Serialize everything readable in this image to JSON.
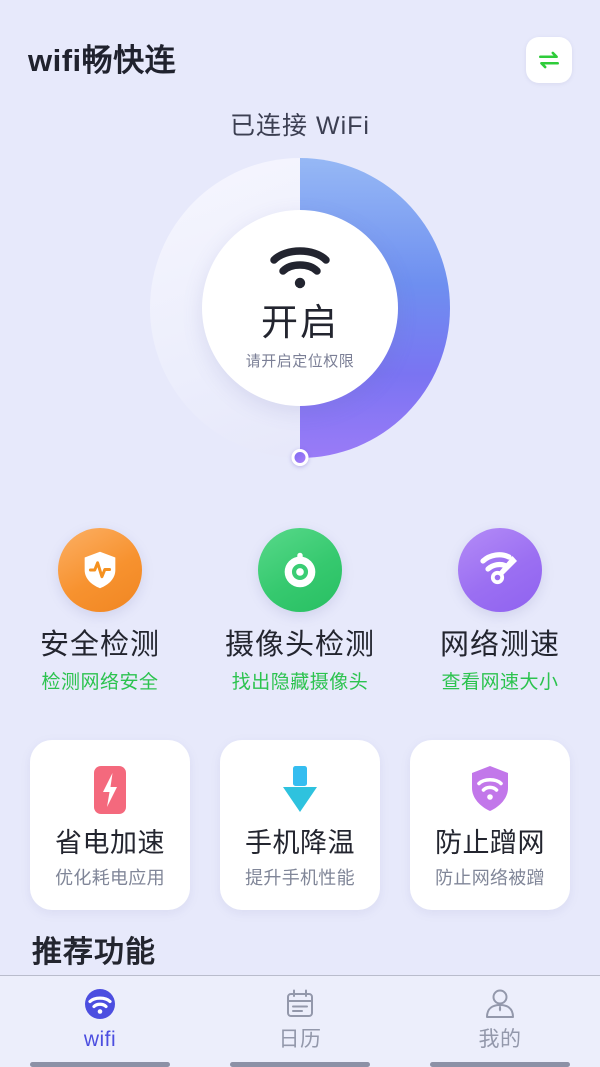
{
  "header": {
    "app_title": "wifi畅快连",
    "swap_button_icon": "swap-arrows-icon",
    "swap_button_color": "#2ecc3a"
  },
  "status": {
    "connected_label": "已连接 WiFi"
  },
  "gauge": {
    "main_text": "开启",
    "sub_text": "请开启定位权限",
    "wifi_icon": "wifi-icon",
    "track_color": "#eceefc",
    "arc_gradient_start": "#96b8f5",
    "arc_gradient_end": "#9a7bf7",
    "knob_color": "#8b72f5",
    "progress_percent": 50
  },
  "round_features": [
    {
      "title": "安全检测",
      "subtitle": "检测网络安全",
      "icon": "shield-pulse-icon",
      "color": "#f7922f"
    },
    {
      "title": "摄像头检测",
      "subtitle": "找出隐藏摄像头",
      "icon": "camera-lens-icon",
      "color": "#36c96f"
    },
    {
      "title": "网络测速",
      "subtitle": "查看网速大小",
      "icon": "wifi-speedometer-icon",
      "color": "#9b6ff2"
    }
  ],
  "card_features": [
    {
      "title": "省电加速",
      "subtitle": "优化耗电应用",
      "icon": "battery-bolt-icon",
      "color": "#f4697d"
    },
    {
      "title": "手机降温",
      "subtitle": "提升手机性能",
      "icon": "arrow-down-icon",
      "color": "#35bdf0"
    },
    {
      "title": "防止蹭网",
      "subtitle": "防止网络被蹭",
      "icon": "shield-wifi-icon",
      "color": "#c277ea"
    }
  ],
  "sections": {
    "recommended_title": "推荐功能"
  },
  "bottom_nav": {
    "active_color": "#4c4ee0",
    "inactive_color": "#9398ab",
    "items": [
      {
        "label": "wifi",
        "icon": "wifi-icon"
      },
      {
        "label": "日历",
        "icon": "calendar-icon"
      },
      {
        "label": "我的",
        "icon": "person-icon"
      }
    ]
  }
}
